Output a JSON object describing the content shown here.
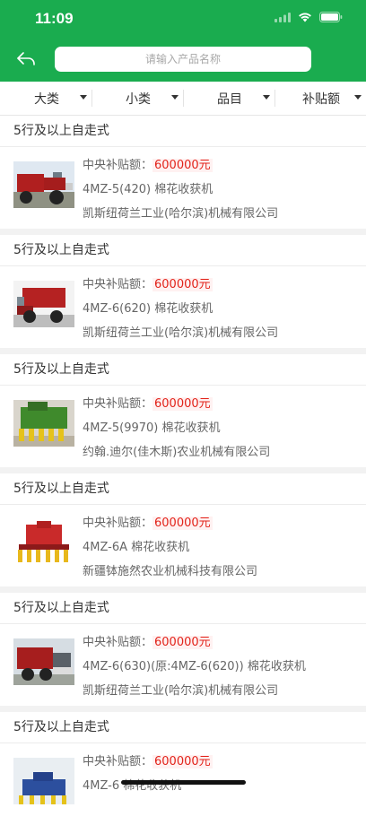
{
  "status_bar": {
    "time": "11:09"
  },
  "nav": {
    "search_placeholder": "请输入产品名称"
  },
  "filters": [
    {
      "label": "大类"
    },
    {
      "label": "小类"
    },
    {
      "label": "品目"
    },
    {
      "label": "补贴额"
    }
  ],
  "subsidy_label": "中央补贴额：",
  "items": [
    {
      "category": "5行及以上自走式",
      "subsidy": "600000元",
      "model": "4MZ-5(420) 棉花收获机",
      "manufacturer": "凯斯纽荷兰工业(哈尔滨)机械有限公司"
    },
    {
      "category": "5行及以上自走式",
      "subsidy": "600000元",
      "model": "4MZ-6(620) 棉花收获机",
      "manufacturer": "凯斯纽荷兰工业(哈尔滨)机械有限公司"
    },
    {
      "category": "5行及以上自走式",
      "subsidy": "600000元",
      "model": "4MZ-5(9970) 棉花收获机",
      "manufacturer": "约翰.迪尔(佳木斯)农业机械有限公司"
    },
    {
      "category": "5行及以上自走式",
      "subsidy": "600000元",
      "model": "4MZ-6A 棉花收获机",
      "manufacturer": "新疆钵施然农业机械科技有限公司"
    },
    {
      "category": "5行及以上自走式",
      "subsidy": "600000元",
      "model": "4MZ-6(630)(原:4MZ-6(620)) 棉花收获机",
      "manufacturer": "凯斯纽荷兰工业(哈尔滨)机械有限公司"
    },
    {
      "category": "5行及以上自走式",
      "subsidy": "600000元",
      "model": "4MZ-6 棉花收获机",
      "manufacturer": ""
    }
  ],
  "colors": {
    "brand_green": "#1aac4f",
    "subsidy_red": "#e2231a",
    "separator": "#f2f2f2"
  }
}
